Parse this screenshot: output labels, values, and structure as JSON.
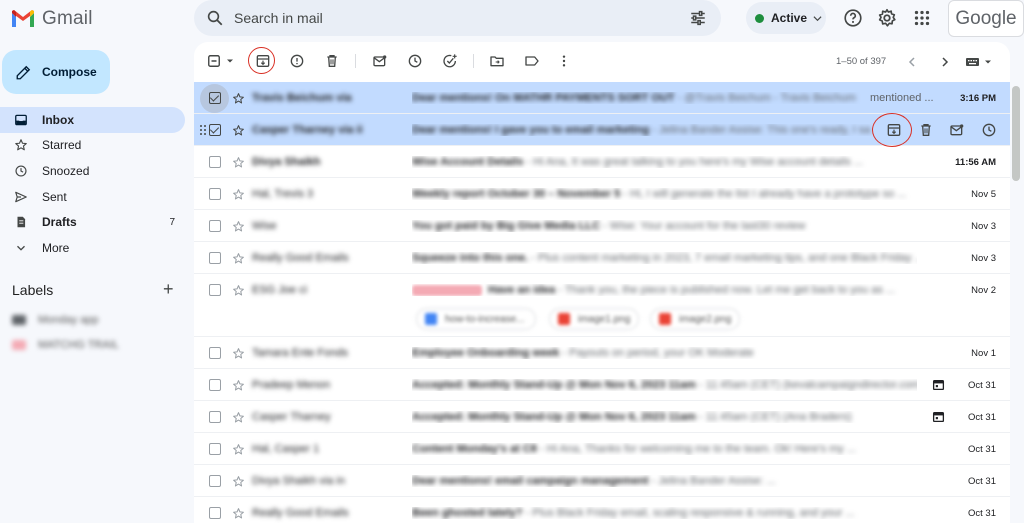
{
  "app": {
    "name": "Gmail",
    "brand": "Google"
  },
  "search": {
    "placeholder": "Search in mail"
  },
  "status": {
    "label": "Active",
    "color": "#1e8e3e"
  },
  "compose": {
    "label": "Compose"
  },
  "nav": [
    {
      "label": "Inbox",
      "icon": "inbox-icon",
      "active": true,
      "count": ""
    },
    {
      "label": "Starred",
      "icon": "star-icon",
      "active": false,
      "count": ""
    },
    {
      "label": "Snoozed",
      "icon": "clock-icon",
      "active": false,
      "count": ""
    },
    {
      "label": "Sent",
      "icon": "send-icon",
      "active": false,
      "count": ""
    },
    {
      "label": "Drafts",
      "icon": "draft-icon",
      "active": false,
      "count": "7"
    },
    {
      "label": "More",
      "icon": "chevron-down-icon",
      "active": false,
      "count": ""
    }
  ],
  "labels": {
    "title": "Labels",
    "items": [
      {
        "text": "Monday app",
        "color": "#5f6368"
      },
      {
        "text": "MATCHG TRAIL",
        "color": "#f4aab4"
      }
    ]
  },
  "pager": {
    "range": "1–50 of 397"
  },
  "emails": [
    {
      "sender": "Travis Beichum via",
      "subject": "Dear mentions! On MATHR PAYMENTS SORT OUT",
      "snippet": " - @Travis Beichum - Travis Beichum",
      "tail": "mentioned ...",
      "date": "3:16 PM",
      "selected": true,
      "unread": true
    },
    {
      "sender": "Casper Tharney via ii",
      "subject": "Dear mentions! I gave you to email marketing",
      "snippet": " - Jelina Bander Assise: This one's ready, I sa ...",
      "tail": "",
      "date": "",
      "selected": true,
      "unread": true
    },
    {
      "sender": "Divya Shaikh",
      "subject": "Wise Account Details",
      "snippet": " - Hi Ana, It was great talking to you here's my Wise account details ...",
      "tail": "",
      "date": "11:56 AM",
      "selected": false,
      "unread": true
    },
    {
      "sender": "Hal, Trevis 3",
      "subject": "Weekly report October 30 – November 5",
      "snippet": " - Hi, I will generate the list I already have a prototype so ...",
      "tail": "",
      "date": "Nov 5",
      "selected": false,
      "unread": false
    },
    {
      "sender": "Wise",
      "subject": "You got paid by Big Give Media LLC",
      "snippet": " - Wise: Your account for the last30 review",
      "tail": "",
      "date": "Nov 3",
      "selected": false,
      "unread": false
    },
    {
      "sender": "Really Good Emails",
      "subject": "Squeeze into this one.",
      "snippet": " - Plus content marketing in 2023, 7 email marketing tips, and one Black Friday ...",
      "tail": "",
      "date": "Nov 3",
      "selected": false,
      "unread": false
    },
    {
      "sender": "ESG Joe ci",
      "subject": "Have an idea",
      "snippet": " - Thank you, the piece is published now. Let me get back to you as ...",
      "tail": "",
      "date": "Nov 2",
      "selected": false,
      "unread": false
    },
    {
      "sender": "Tamara Ente Fonds",
      "subject": "Employee Onboarding week",
      "snippet": " - Payouts on period, your OK Moderate",
      "tail": "",
      "date": "Nov 1",
      "selected": false,
      "unread": false
    },
    {
      "sender": "Pradeep Menon",
      "subject": "Accepted: Monthly Stand-Up @ Mon Nov 6, 2023 11am",
      "snippet": " - 11:45am (CET) (kevalcampaigndirector.com)",
      "tail": "",
      "date": "Oct 31",
      "selected": false,
      "unread": false
    },
    {
      "sender": "Casper Tharney",
      "subject": "Accepted: Monthly Stand-Up @ Mon Nov 6, 2023 11am",
      "snippet": " - 11:45am (CET) (Ana Braders)",
      "tail": "",
      "date": "Oct 31",
      "selected": false,
      "unread": false
    },
    {
      "sender": "Hal, Casper 1",
      "subject": "Content Monday's at C8",
      "snippet": " - Hi Ana, Thanks for welcoming me to the team. Ok! Here's my ...",
      "tail": "",
      "date": "Oct 31",
      "selected": false,
      "unread": false
    },
    {
      "sender": "Divya Shaikh via in",
      "subject": "Dear mentions! email campaign management",
      "snippet": " - Jelina Bander Assise: ...",
      "tail": "",
      "date": "Oct 31",
      "selected": false,
      "unread": false
    },
    {
      "sender": "Really Good Emails",
      "subject": "Been ghosted lately?",
      "snippet": " - Plus Black Friday email, scaling responsive & running, and your ...",
      "tail": "",
      "date": "Oct 31",
      "selected": false,
      "unread": false
    }
  ],
  "attachments": [
    {
      "label": "how-to-increase...",
      "color": "#4285f4"
    },
    {
      "label": "image1.png",
      "color": "#ea4335"
    },
    {
      "label": "image2.png",
      "color": "#ea4335"
    }
  ]
}
